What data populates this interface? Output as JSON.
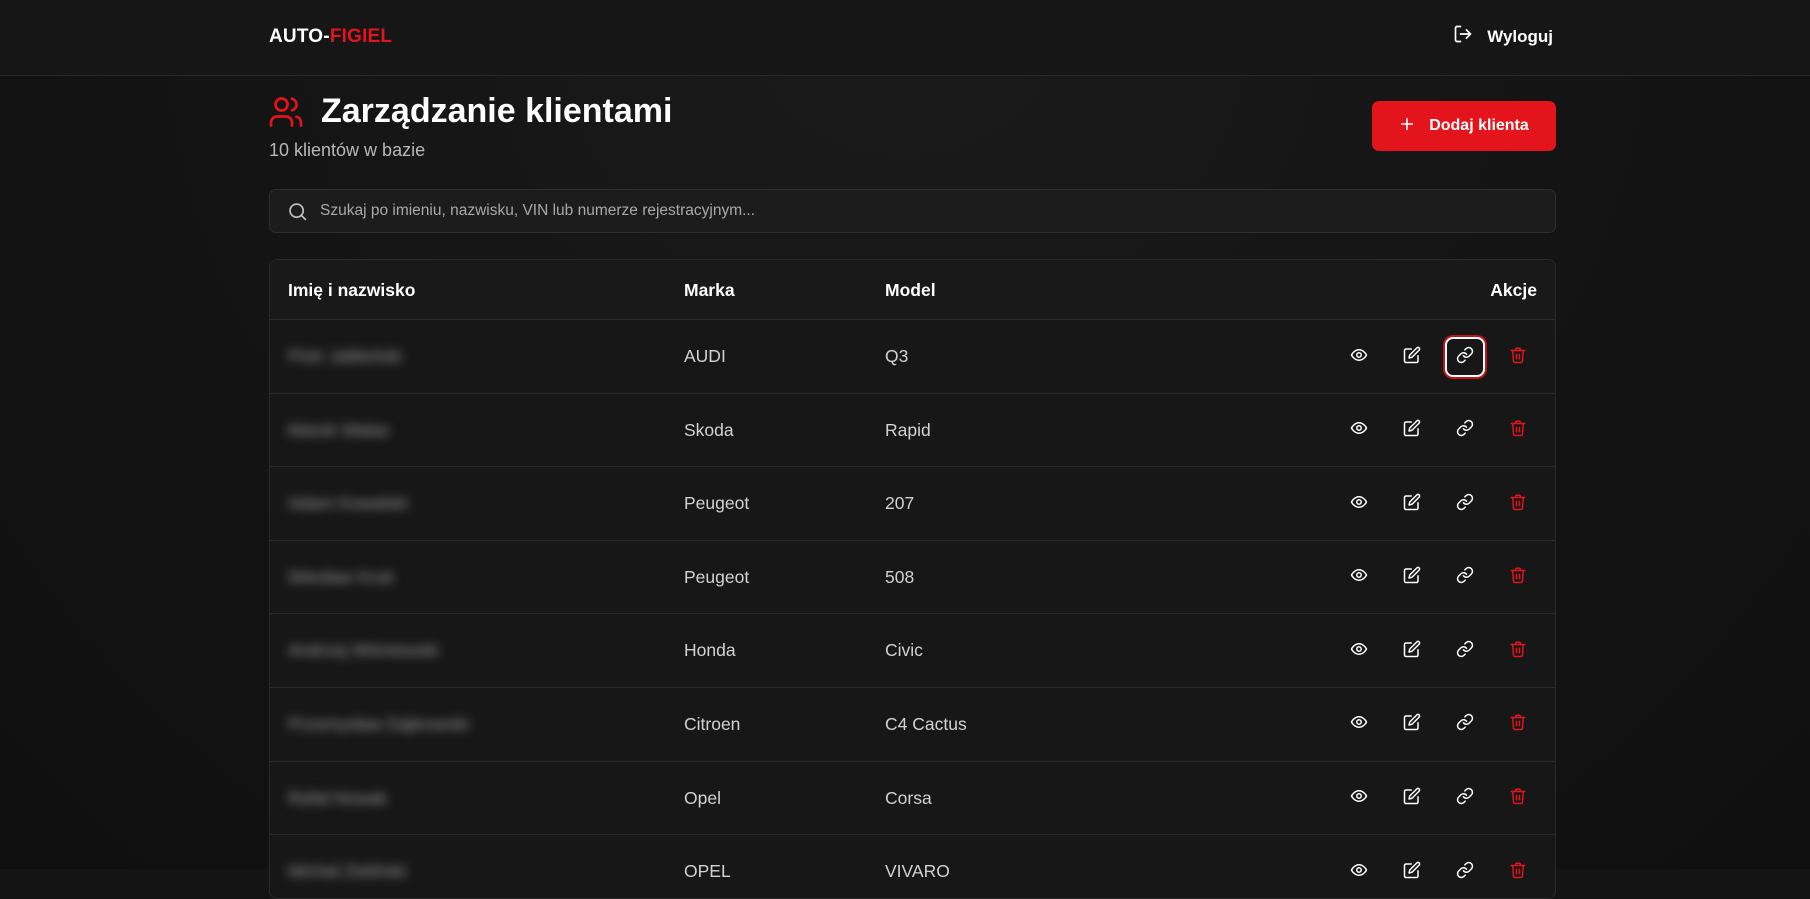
{
  "brand": {
    "part1": "AUTO-",
    "part2": "FIGIEL"
  },
  "header": {
    "logout_label": "Wyloguj"
  },
  "page": {
    "title": "Zarządzanie klientami",
    "subtitle": "10 klientów w bazie",
    "add_button_label": "Dodaj klienta"
  },
  "search": {
    "placeholder": "Szukaj po imieniu, nazwisku, VIN lub numerze rejestracyjnym..."
  },
  "table": {
    "columns": {
      "name": "Imię i nazwisko",
      "brand": "Marka",
      "model": "Model",
      "actions": "Akcje"
    },
    "rows": [
      {
        "name": "Piotr Jabłoński",
        "brand": "AUDI",
        "model": "Q3"
      },
      {
        "name": "Marek Walas",
        "brand": "Skoda",
        "model": "Rapid"
      },
      {
        "name": "Adam Kowalski",
        "brand": "Peugeot",
        "model": "207"
      },
      {
        "name": "Wiesław Kruk",
        "brand": "Peugeot",
        "model": "508"
      },
      {
        "name": "Andrzej Wiśniewski",
        "brand": "Honda",
        "model": "Civic"
      },
      {
        "name": "Przemysław Dąbrowski",
        "brand": "Citroen",
        "model": "C4 Cactus"
      },
      {
        "name": "Rafał Nowak",
        "brand": "Opel",
        "model": "Corsa"
      },
      {
        "name": "Michał Zieliński",
        "brand": "OPEL",
        "model": "VIVARO"
      }
    ]
  },
  "colors": {
    "accent": "#e3141b",
    "background": "#141414",
    "delete": "#e3141b"
  },
  "icons": {
    "header": "users-icon",
    "logout": "logout-icon",
    "add": "plus-icon",
    "search": "search-icon",
    "actions": [
      "eye-icon",
      "pencil-square-icon",
      "link-icon",
      "trash-icon"
    ]
  }
}
